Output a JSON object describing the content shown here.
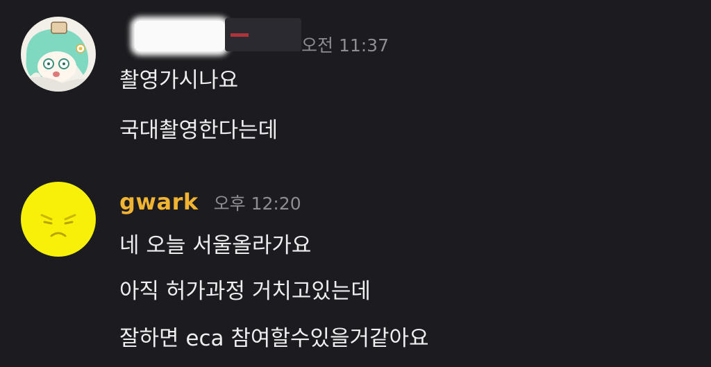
{
  "messages": [
    {
      "username": "",
      "username_color": "#ffffff",
      "timestamp": "오전 11:37",
      "avatar_icon": "anime-character-avatar",
      "lines": [
        "촬영가시나요",
        "국대촬영한다는데"
      ]
    },
    {
      "username": "gwark",
      "username_color": "#f0b332",
      "timestamp": "오후 12:20",
      "avatar_icon": "angry-face-avatar",
      "lines": [
        "네 오늘 서울올라가요",
        "아직 허가과정 거치고있는데",
        "잘하면 eca 참여할수있을거같아요"
      ]
    }
  ]
}
